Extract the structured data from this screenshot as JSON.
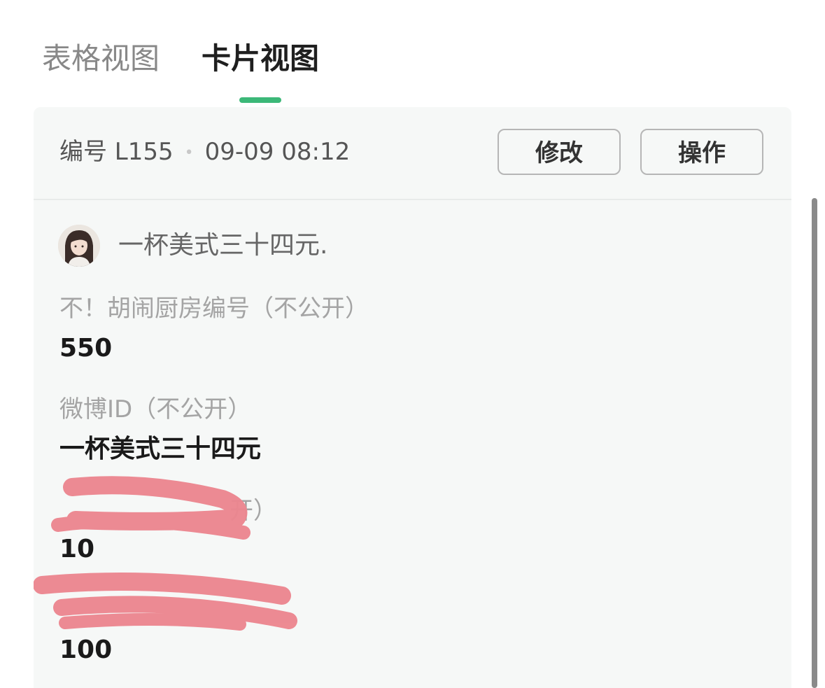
{
  "tabs": [
    {
      "label": "表格视图",
      "active": false
    },
    {
      "label": "卡片视图",
      "active": true
    }
  ],
  "colors": {
    "accent": "#3cb878",
    "card_background": "#f6f8f7",
    "redaction": "#ec8790"
  },
  "card": {
    "header": {
      "number": "编号 L155",
      "separator": "•",
      "timestamp": "09-09 08:12",
      "edit_label": "修改",
      "actions_label": "操作"
    },
    "user": {
      "name": "一杯美式三十四元."
    },
    "fields": [
      {
        "label": "不！胡闹厨房编号（不公开）",
        "value": "550"
      },
      {
        "label": "微博ID（不公开）",
        "value": "一杯美式三十四元"
      },
      {
        "label": "开）",
        "value": "10"
      },
      {
        "label": "",
        "value": "100"
      }
    ]
  }
}
